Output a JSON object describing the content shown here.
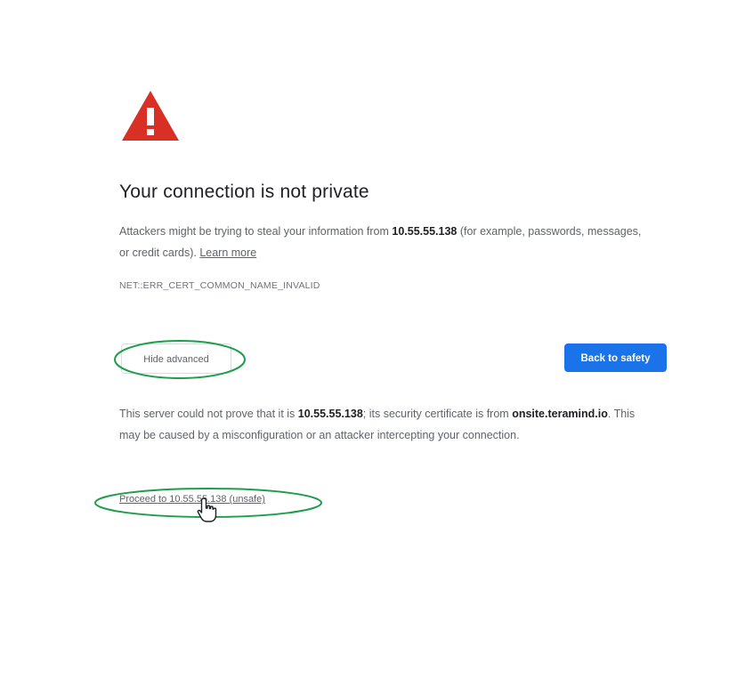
{
  "interstitial": {
    "icon": "warning-triangle-icon",
    "title": "Your connection is not private",
    "intro_before": "Attackers might be trying to steal your information from ",
    "host": "10.55.55.138",
    "intro_after": " (for example, passwords, messages, or credit cards). ",
    "learn_more": "Learn more",
    "error_code": "NET::ERR_CERT_COMMON_NAME_INVALID",
    "hide_advanced": "Hide advanced",
    "back_to_safety": "Back to safety",
    "details_before": "This server could not prove that it is ",
    "details_host": "10.55.55.138",
    "details_middle": "; its security certificate is from ",
    "cert_domain": "onsite.teramind.io",
    "details_after": ". This may be caused by a misconfiguration or an attacker intercepting your connection.",
    "proceed_link": "Proceed to 10.55.55.138 (unsafe)"
  },
  "colors": {
    "warning_red": "#d93025",
    "primary_blue": "#1a73e8",
    "annotation_green": "#1e9e4a"
  }
}
